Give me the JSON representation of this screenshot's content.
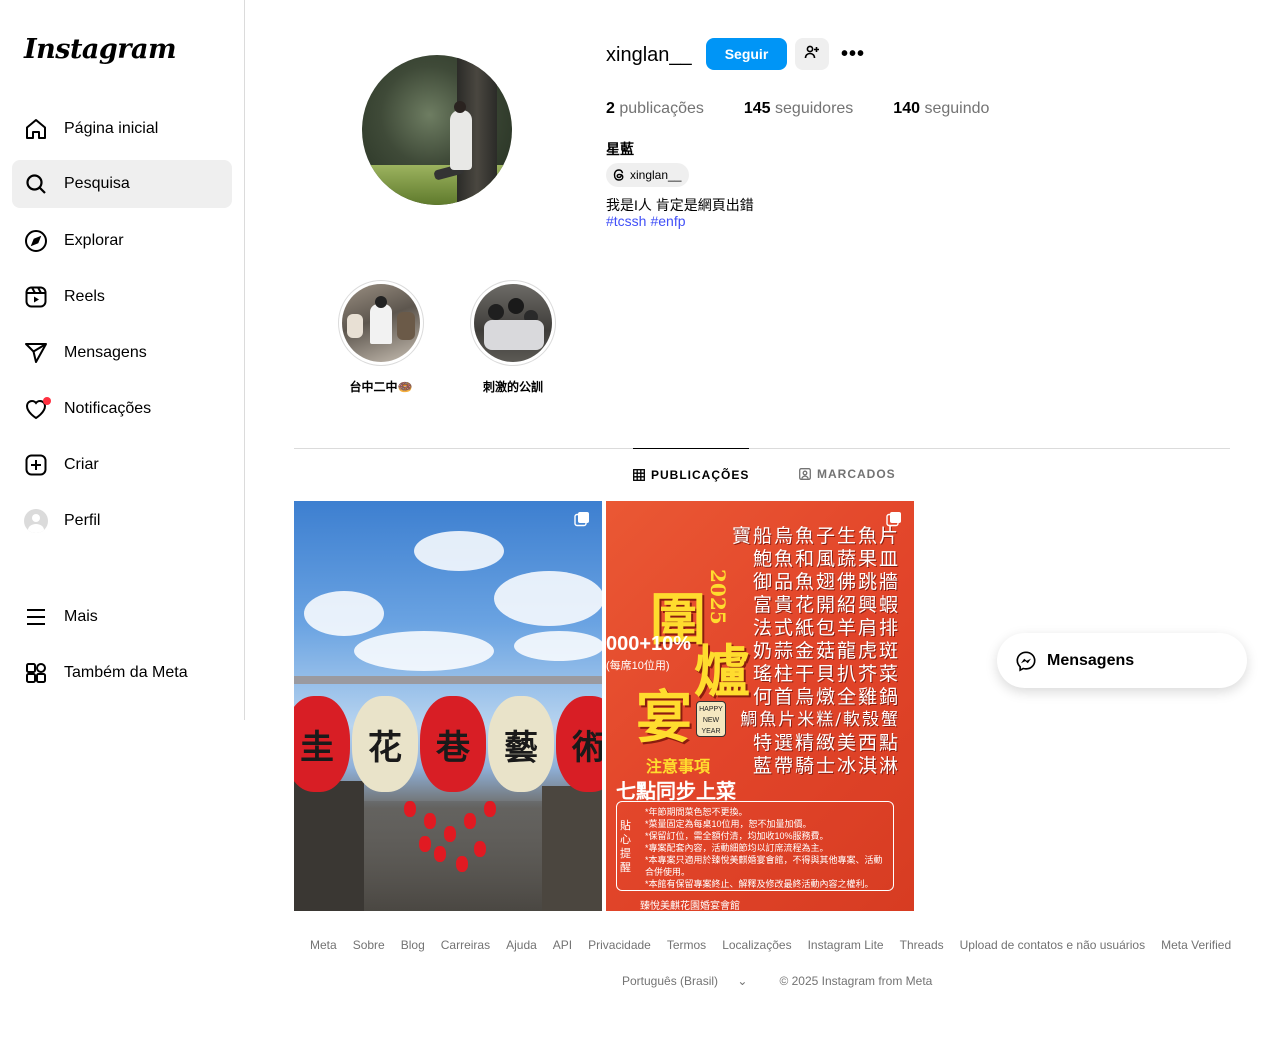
{
  "sidebar": {
    "logo": "Instagram",
    "items": [
      {
        "label": "Página inicial",
        "icon": "home-icon"
      },
      {
        "label": "Pesquisa",
        "icon": "search-icon"
      },
      {
        "label": "Explorar",
        "icon": "compass-icon"
      },
      {
        "label": "Reels",
        "icon": "reels-icon"
      },
      {
        "label": "Mensagens",
        "icon": "send-icon"
      },
      {
        "label": "Notificações",
        "icon": "heart-icon"
      },
      {
        "label": "Criar",
        "icon": "plus-square-icon"
      },
      {
        "label": "Perfil",
        "icon": "avatar"
      },
      {
        "label": "Mais",
        "icon": "menu-icon"
      },
      {
        "label": "Também da Meta",
        "icon": "meta-apps-icon"
      }
    ]
  },
  "profile": {
    "username": "xinglan__",
    "follow_label": "Seguir",
    "stats": {
      "posts_count": "2",
      "posts_label": "publicações",
      "followers_count": "145",
      "followers_label": "seguidores",
      "following_count": "140",
      "following_label": "seguindo"
    },
    "full_name": "星藍",
    "threads_handle": "xinglan__",
    "bio": "我是I人 肯定是網頁出錯",
    "hashtags": [
      "#tcssh",
      "#enfp"
    ]
  },
  "highlights": [
    {
      "label": "台中二中🍩"
    },
    {
      "label": "刺激的公訓"
    }
  ],
  "tabs": {
    "posts": "PUBLICAÇÕES",
    "tagged": "MARCADOS"
  },
  "post1": {
    "lanterns": [
      "圭",
      "花",
      "巷",
      "藝",
      "術"
    ]
  },
  "post2": {
    "year": "2025",
    "title_chars": [
      "圍",
      "爐",
      "宴"
    ],
    "price": "000+10%",
    "price_note": "(每席10位用)",
    "menu": [
      "寶船烏魚子生魚片",
      "鮑魚和風蔬果皿",
      "御品魚翅佛跳牆",
      "富貴花開紹興蝦",
      "法式紙包羊肩排",
      "奶蒜金菇龍虎斑",
      "瑤柱干貝扒芥菜",
      "何首烏燉全雞鍋",
      "鯛魚片米糕/軟殼蟹",
      "特選精緻美西點",
      "藍帶騎士冰淇淋"
    ],
    "notice_title": "注意事項",
    "notice_subtitle": "七點同步上菜",
    "notice_side": "貼心提醒",
    "notice_lines": [
      "*年節期間菜色恕不更換。",
      "*菜量固定為每桌10位用，恕不加量加價。",
      "*保留訂位，需全額付清，均加收10%服務費。",
      "*專案配套內容，活動細節均以訂席流程為主。",
      "*本專案只適用於臻悅美麒婚宴會館，不得與其他專案、活動合併使用。",
      "*本館有保留專案終止、解釋及修改最終活動內容之權利。"
    ],
    "footer": "臻悅美麒花園婚宴會館",
    "hny": "HAPPY NEW YEAR"
  },
  "footer": {
    "links": [
      "Meta",
      "Sobre",
      "Blog",
      "Carreiras",
      "Ajuda",
      "API",
      "Privacidade",
      "Termos",
      "Localizações",
      "Instagram Lite",
      "Threads",
      "Upload de contatos e não usuários",
      "Meta Verified"
    ],
    "language": "Português (Brasil)",
    "copyright": "© 2025 Instagram from Meta"
  },
  "messages_float": {
    "label": "Mensagens"
  },
  "colors": {
    "accent": "#0095f6",
    "notification": "#ff3040",
    "hashtag": "#4150f7"
  }
}
